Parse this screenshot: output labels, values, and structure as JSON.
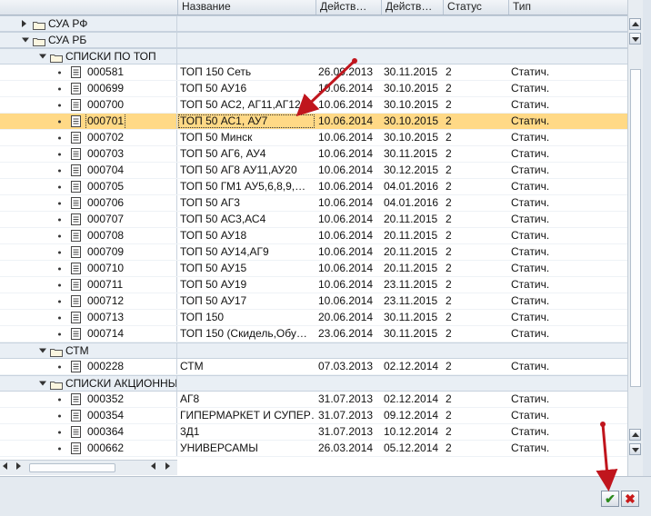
{
  "columns": [
    "",
    "Название",
    "Действ…",
    "Действ…",
    "Статус",
    "Тип"
  ],
  "folders": {
    "sua_rf": "СУА РФ",
    "sua_rb": "СУА РБ",
    "top_lists": "СПИСКИ ПО ТОП",
    "stm": "СТМ",
    "promo_lists": "СПИСКИ АКЦИОННЫ"
  },
  "top_rows": [
    {
      "id": "000581",
      "name": "ТОП 150 Сеть",
      "from": "26.09.2013",
      "to": "30.11.2015",
      "status": "2",
      "type": "Статич."
    },
    {
      "id": "000699",
      "name": "ТОП 50 АУ16",
      "from": "10.06.2014",
      "to": "30.10.2015",
      "status": "2",
      "type": "Статич."
    },
    {
      "id": "000700",
      "name": "ТОП 50 АС2, АГ11,АГ12",
      "from": "10.06.2014",
      "to": "30.10.2015",
      "status": "2",
      "type": "Статич."
    },
    {
      "id": "000701",
      "name": "ТОП 50 АС1, АУ7",
      "from": "10.06.2014",
      "to": "30.10.2015",
      "status": "2",
      "type": "Статич."
    },
    {
      "id": "000702",
      "name": "ТОП 50 Минск",
      "from": "10.06.2014",
      "to": "30.10.2015",
      "status": "2",
      "type": "Статич."
    },
    {
      "id": "000703",
      "name": "ТОП 50 АГ6, АУ4",
      "from": "10.06.2014",
      "to": "30.11.2015",
      "status": "2",
      "type": "Статич."
    },
    {
      "id": "000704",
      "name": "ТОП 50 АГ8 АУ11,АУ20",
      "from": "10.06.2014",
      "to": "30.12.2015",
      "status": "2",
      "type": "Статич."
    },
    {
      "id": "000705",
      "name": "ТОП 50 ГМ1 АУ5,6,8,9,…",
      "from": "10.06.2014",
      "to": "04.01.2016",
      "status": "2",
      "type": "Статич."
    },
    {
      "id": "000706",
      "name": "ТОП 50 АГ3",
      "from": "10.06.2014",
      "to": "04.01.2016",
      "status": "2",
      "type": "Статич."
    },
    {
      "id": "000707",
      "name": "ТОП 50 АС3,АС4",
      "from": "10.06.2014",
      "to": "20.11.2015",
      "status": "2",
      "type": "Статич."
    },
    {
      "id": "000708",
      "name": "ТОП 50 АУ18",
      "from": "10.06.2014",
      "to": "20.11.2015",
      "status": "2",
      "type": "Статич."
    },
    {
      "id": "000709",
      "name": "ТОП 50 АУ14,АГ9",
      "from": "10.06.2014",
      "to": "20.11.2015",
      "status": "2",
      "type": "Статич."
    },
    {
      "id": "000710",
      "name": "ТОП 50 АУ15",
      "from": "10.06.2014",
      "to": "20.11.2015",
      "status": "2",
      "type": "Статич."
    },
    {
      "id": "000711",
      "name": "ТОП 50 АУ19",
      "from": "10.06.2014",
      "to": "23.11.2015",
      "status": "2",
      "type": "Статич."
    },
    {
      "id": "000712",
      "name": "ТОП 50 АУ17",
      "from": "10.06.2014",
      "to": "23.11.2015",
      "status": "2",
      "type": "Статич."
    },
    {
      "id": "000713",
      "name": "ТОП 150",
      "from": "20.06.2014",
      "to": "30.11.2015",
      "status": "2",
      "type": "Статич."
    },
    {
      "id": "000714",
      "name": "ТОП 150 (Скидель,Обу…",
      "from": "23.06.2014",
      "to": "30.11.2015",
      "status": "2",
      "type": "Статич."
    }
  ],
  "stm_rows": [
    {
      "id": "000228",
      "name": "СТМ",
      "from": "07.03.2013",
      "to": "02.12.2014",
      "status": "2",
      "type": "Статич."
    }
  ],
  "promo_rows": [
    {
      "id": "000352",
      "name": "АГ8",
      "from": "31.07.2013",
      "to": "02.12.2014",
      "status": "2",
      "type": "Статич."
    },
    {
      "id": "000354",
      "name": "ГИПЕРМАРКЕТ И СУПЕР…",
      "from": "31.07.2013",
      "to": "09.12.2014",
      "status": "2",
      "type": "Статич."
    },
    {
      "id": "000364",
      "name": "3Д1",
      "from": "31.07.2013",
      "to": "10.12.2014",
      "status": "2",
      "type": "Статич."
    },
    {
      "id": "000662",
      "name": "УНИВЕРСАМЫ",
      "from": "26.03.2014",
      "to": "05.12.2014",
      "status": "2",
      "type": "Статич."
    }
  ],
  "selected_id": "000701",
  "buttons": {
    "confirm": "✔",
    "cancel": "✖"
  },
  "colors": {
    "selected_row": "#ffd986",
    "annotation_arrow": "#c0151d"
  }
}
